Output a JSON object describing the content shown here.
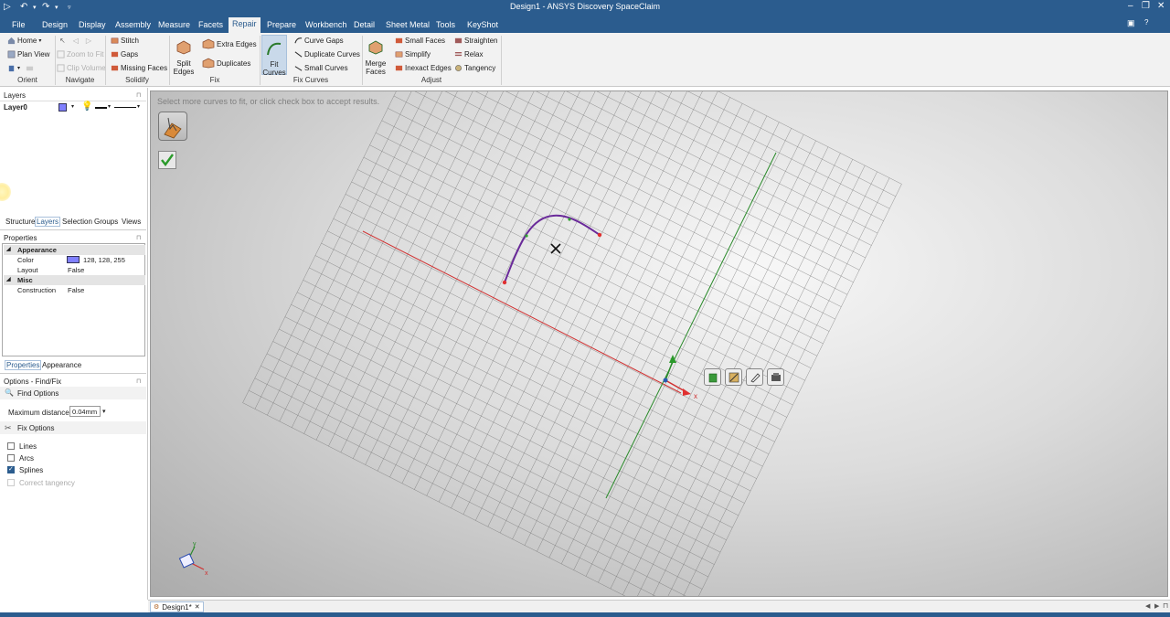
{
  "window": {
    "title": "Design1 - ANSYS Discovery SpaceClaim"
  },
  "menu": {
    "tabs": [
      "File",
      "Design",
      "Display",
      "Assembly",
      "Measure",
      "Facets",
      "Repair",
      "Prepare",
      "Workbench",
      "Detail",
      "Sheet Metal",
      "Tools",
      "KeyShot"
    ],
    "active": "Repair"
  },
  "ribbon": {
    "orient": {
      "home": "Home",
      "plan_view": "Plan View",
      "group": "Orient"
    },
    "navigate": {
      "zoom_to_fit": "Zoom to Fit",
      "clip_volume": "Clip Volume",
      "group": "Navigate"
    },
    "solidify": {
      "stitch": "Stitch",
      "gaps": "Gaps",
      "missing_faces": "Missing Faces",
      "group": "Solidify"
    },
    "fix": {
      "split_edges_1": "Split",
      "split_edges_2": "Edges",
      "extra_edges": "Extra Edges",
      "duplicates": "Duplicates",
      "group": "Fix"
    },
    "fix_curves": {
      "fit_curves_1": "Fit",
      "fit_curves_2": "Curves",
      "curve_gaps": "Curve Gaps",
      "duplicate_curves": "Duplicate Curves",
      "small_curves": "Small Curves",
      "group": "Fix Curves"
    },
    "adjust": {
      "merge_faces_1": "Merge",
      "merge_faces_2": "Faces",
      "small_faces": "Small Faces",
      "simplify": "Simplify",
      "inexact_edges": "Inexact Edges",
      "straighten": "Straighten",
      "relax": "Relax",
      "tangency": "Tangency",
      "group": "Adjust"
    }
  },
  "layers_panel": {
    "title": "Layers",
    "layer_name": "Layer0"
  },
  "panel_tabs": [
    "Structure",
    "Layers",
    "Selection",
    "Groups",
    "Views"
  ],
  "properties": {
    "title": "Properties",
    "rows": [
      {
        "key": "Appearance",
        "header": true
      },
      {
        "key": "Color",
        "value": "128, 128, 255"
      },
      {
        "key": "Layout",
        "value": "False"
      },
      {
        "key": "Misc",
        "header": true
      },
      {
        "key": "Construction",
        "value": "False"
      }
    ],
    "tabs": [
      "Properties",
      "Appearance"
    ],
    "color_swatch": "#8080ff"
  },
  "options": {
    "title": "Options - Find/Fix",
    "find_options": "Find Options",
    "max_distance_label": "Maximum distance:",
    "max_distance_value": "0.04mm",
    "fix_options": "Fix Options",
    "checks": [
      {
        "label": "Lines",
        "checked": false,
        "enabled": true
      },
      {
        "label": "Arcs",
        "checked": false,
        "enabled": true
      },
      {
        "label": "Splines",
        "checked": true,
        "enabled": true
      },
      {
        "label": "Correct tangency",
        "checked": false,
        "enabled": false
      }
    ]
  },
  "viewport": {
    "hint": "Select more curves to fit, or click check box to accept results.",
    "axis_x": "x",
    "triad_x": "x",
    "triad_y": "y"
  },
  "document": {
    "tab_label": "Design1*"
  }
}
